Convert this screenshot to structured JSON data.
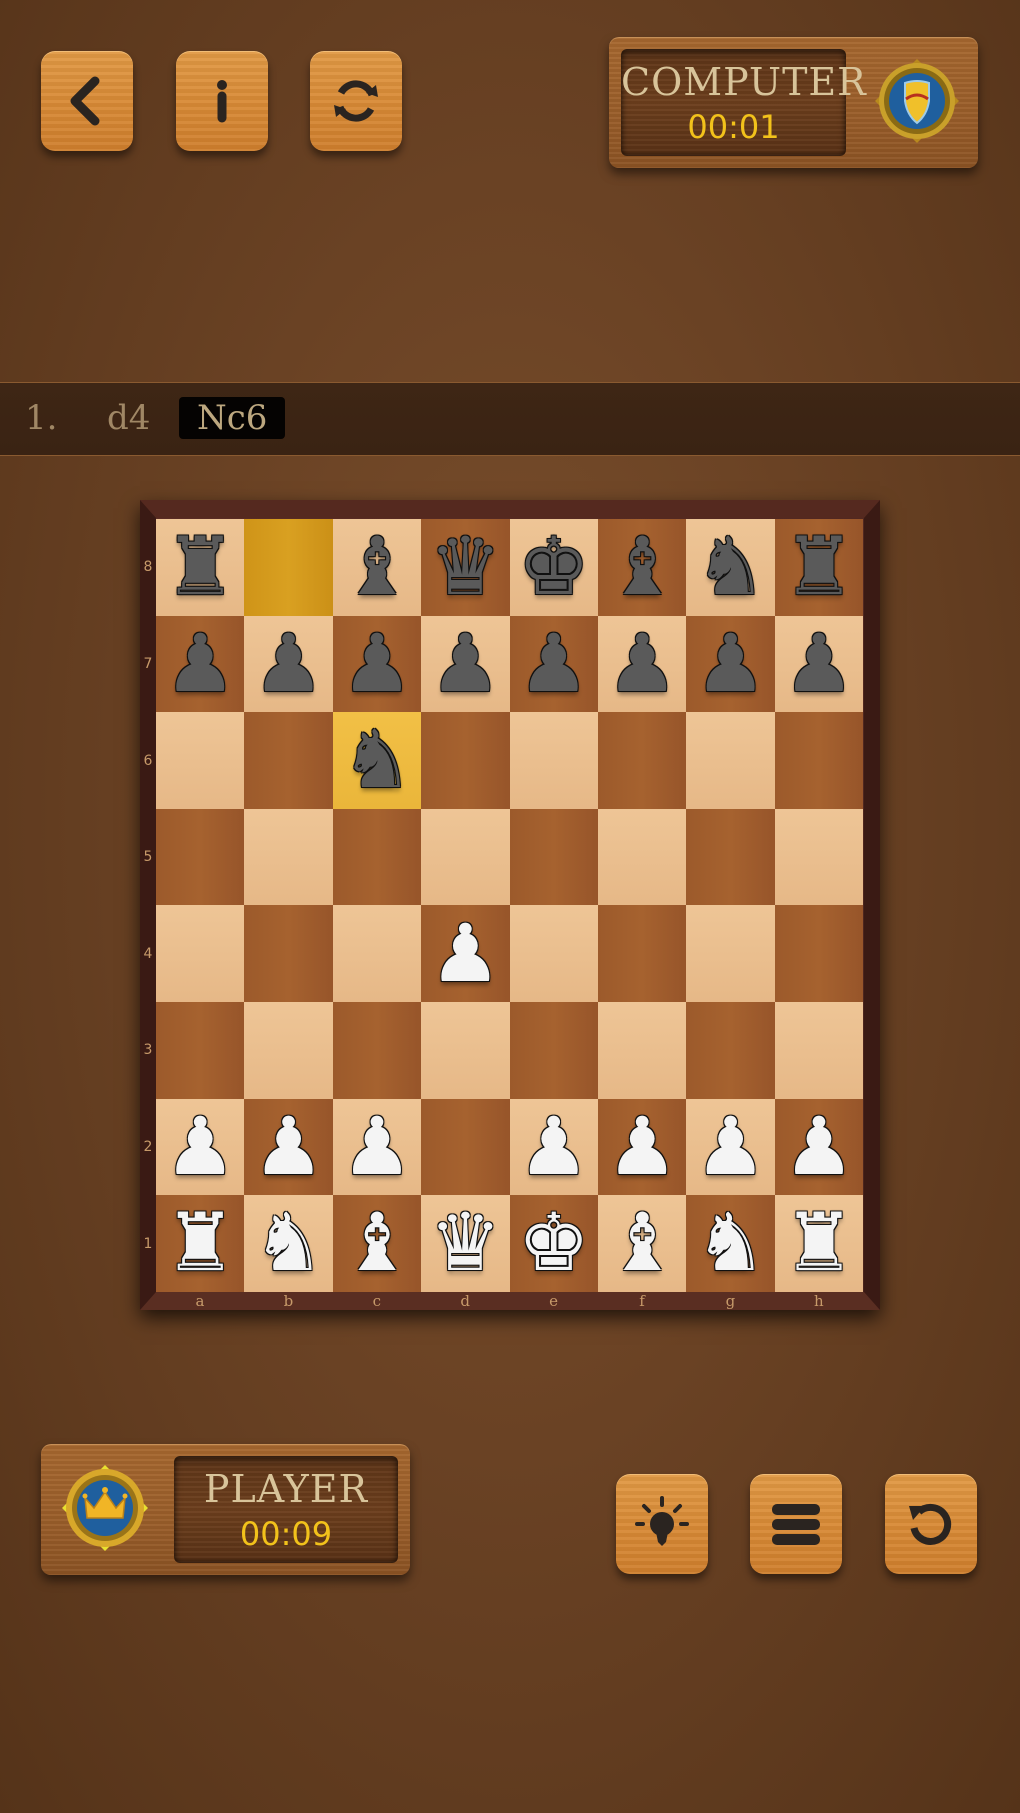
{
  "top_toolbar": {
    "buttons": [
      {
        "name": "back-button",
        "icon": "chevron-left-icon"
      },
      {
        "name": "info-button",
        "icon": "info-icon"
      },
      {
        "name": "flip-board-button",
        "icon": "refresh-icon"
      }
    ]
  },
  "opponent": {
    "name": "COMPUTER",
    "time": "00:01",
    "badge_icon": "shield-badge-icon"
  },
  "player": {
    "name": "PLAYER",
    "time": "00:09",
    "badge_icon": "crown-badge-icon"
  },
  "move_list": {
    "moves": [
      {
        "number": "1.",
        "white": "d4",
        "black": "Nc6",
        "current": "black"
      }
    ]
  },
  "board": {
    "files": [
      "a",
      "b",
      "c",
      "d",
      "e",
      "f",
      "g",
      "h"
    ],
    "ranks": [
      "8",
      "7",
      "6",
      "5",
      "4",
      "3",
      "2",
      "1"
    ],
    "last_move": {
      "from": "b8",
      "to": "c6"
    },
    "pieces": [
      {
        "sq": "a8",
        "color": "b",
        "type": "rook",
        "glyph": "♜"
      },
      {
        "sq": "c8",
        "color": "b",
        "type": "bishop",
        "glyph": "♝"
      },
      {
        "sq": "d8",
        "color": "b",
        "type": "queen",
        "glyph": "♛"
      },
      {
        "sq": "e8",
        "color": "b",
        "type": "king",
        "glyph": "♚"
      },
      {
        "sq": "f8",
        "color": "b",
        "type": "bishop",
        "glyph": "♝"
      },
      {
        "sq": "g8",
        "color": "b",
        "type": "knight",
        "glyph": "♞"
      },
      {
        "sq": "h8",
        "color": "b",
        "type": "rook",
        "glyph": "♜"
      },
      {
        "sq": "a7",
        "color": "b",
        "type": "pawn",
        "glyph": "♟"
      },
      {
        "sq": "b7",
        "color": "b",
        "type": "pawn",
        "glyph": "♟"
      },
      {
        "sq": "c7",
        "color": "b",
        "type": "pawn",
        "glyph": "♟"
      },
      {
        "sq": "d7",
        "color": "b",
        "type": "pawn",
        "glyph": "♟"
      },
      {
        "sq": "e7",
        "color": "b",
        "type": "pawn",
        "glyph": "♟"
      },
      {
        "sq": "f7",
        "color": "b",
        "type": "pawn",
        "glyph": "♟"
      },
      {
        "sq": "g7",
        "color": "b",
        "type": "pawn",
        "glyph": "♟"
      },
      {
        "sq": "h7",
        "color": "b",
        "type": "pawn",
        "glyph": "♟"
      },
      {
        "sq": "c6",
        "color": "b",
        "type": "knight",
        "glyph": "♞"
      },
      {
        "sq": "d4",
        "color": "w",
        "type": "pawn",
        "glyph": "♟"
      },
      {
        "sq": "a2",
        "color": "w",
        "type": "pawn",
        "glyph": "♟"
      },
      {
        "sq": "b2",
        "color": "w",
        "type": "pawn",
        "glyph": "♟"
      },
      {
        "sq": "c2",
        "color": "w",
        "type": "pawn",
        "glyph": "♟"
      },
      {
        "sq": "e2",
        "color": "w",
        "type": "pawn",
        "glyph": "♟"
      },
      {
        "sq": "f2",
        "color": "w",
        "type": "pawn",
        "glyph": "♟"
      },
      {
        "sq": "g2",
        "color": "w",
        "type": "pawn",
        "glyph": "♟"
      },
      {
        "sq": "h2",
        "color": "w",
        "type": "pawn",
        "glyph": "♟"
      },
      {
        "sq": "a1",
        "color": "w",
        "type": "rook",
        "glyph": "♜"
      },
      {
        "sq": "b1",
        "color": "w",
        "type": "knight",
        "glyph": "♞"
      },
      {
        "sq": "c1",
        "color": "w",
        "type": "bishop",
        "glyph": "♝"
      },
      {
        "sq": "d1",
        "color": "w",
        "type": "queen",
        "glyph": "♛"
      },
      {
        "sq": "e1",
        "color": "w",
        "type": "king",
        "glyph": "♚"
      },
      {
        "sq": "f1",
        "color": "w",
        "type": "bishop",
        "glyph": "♝"
      },
      {
        "sq": "g1",
        "color": "w",
        "type": "knight",
        "glyph": "♞"
      },
      {
        "sq": "h1",
        "color": "w",
        "type": "rook",
        "glyph": "♜"
      }
    ]
  },
  "bottom_toolbar": {
    "buttons": [
      {
        "name": "hint-button",
        "icon": "lightbulb-icon"
      },
      {
        "name": "menu-button",
        "icon": "hamburger-menu-icon"
      },
      {
        "name": "undo-button",
        "icon": "undo-icon"
      }
    ]
  },
  "colors": {
    "time_text": "#f2c21b",
    "name_text": "#d8c49a",
    "highlight_to": "#f2c046",
    "highlight_from": "#d9a021",
    "light_square": "#eec596",
    "dark_square": "#a6622f"
  }
}
